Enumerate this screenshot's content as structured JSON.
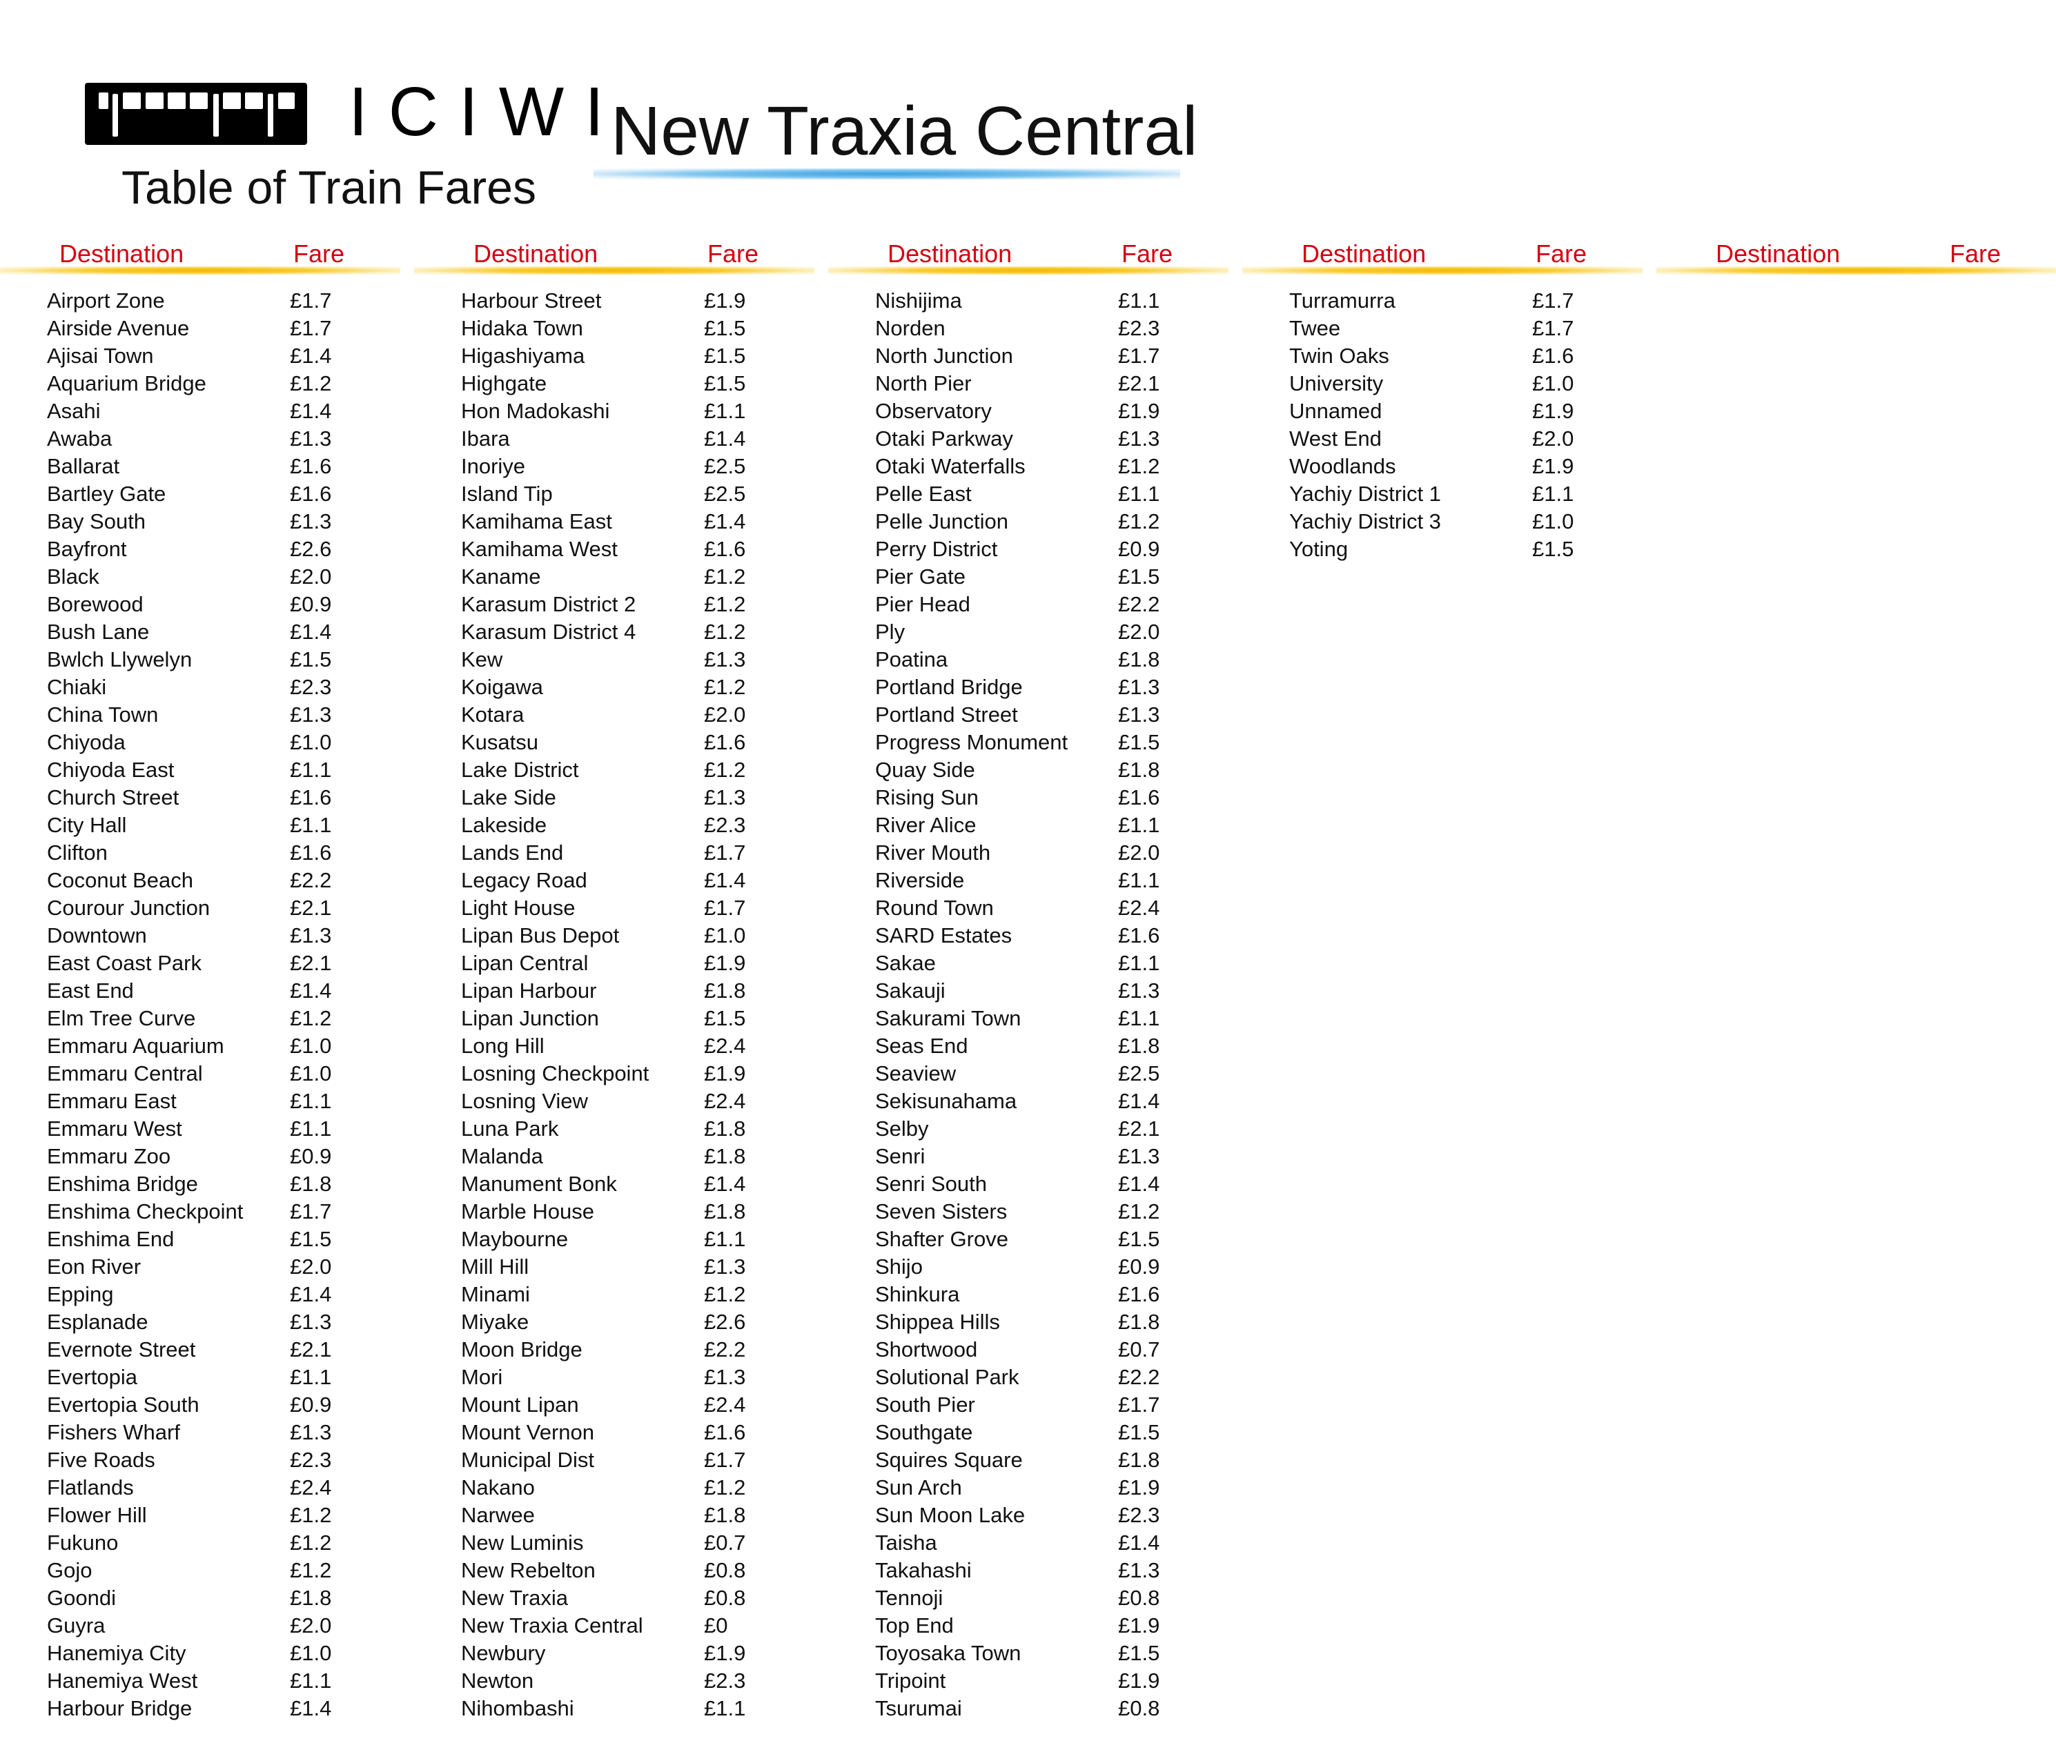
{
  "header": {
    "brand": "ICIWI",
    "subtitle": "Table of Train Fares",
    "station": "New Traxia Central"
  },
  "table": {
    "dest_header": "Destination",
    "fare_header": "Fare",
    "columns": [
      [
        {
          "d": "Airport Zone",
          "f": "£1.7"
        },
        {
          "d": "Airside Avenue",
          "f": "£1.7"
        },
        {
          "d": "Ajisai Town",
          "f": "£1.4"
        },
        {
          "d": "Aquarium Bridge",
          "f": "£1.2"
        },
        {
          "d": "Asahi",
          "f": "£1.4"
        },
        {
          "d": "Awaba",
          "f": "£1.3"
        },
        {
          "d": "Ballarat",
          "f": "£1.6"
        },
        {
          "d": "Bartley Gate",
          "f": "£1.6"
        },
        {
          "d": "Bay South",
          "f": "£1.3"
        },
        {
          "d": "Bayfront",
          "f": "£2.6"
        },
        {
          "d": "Black",
          "f": "£2.0"
        },
        {
          "d": "Borewood",
          "f": "£0.9"
        },
        {
          "d": "Bush Lane",
          "f": "£1.4"
        },
        {
          "d": "Bwlch Llywelyn",
          "f": "£1.5"
        },
        {
          "d": "Chiaki",
          "f": "£2.3"
        },
        {
          "d": "China Town",
          "f": "£1.3"
        },
        {
          "d": "Chiyoda",
          "f": "£1.0"
        },
        {
          "d": "Chiyoda East",
          "f": "£1.1"
        },
        {
          "d": "Church Street",
          "f": "£1.6"
        },
        {
          "d": "City Hall",
          "f": "£1.1"
        },
        {
          "d": "Clifton",
          "f": "£1.6"
        },
        {
          "d": "Coconut Beach",
          "f": "£2.2"
        },
        {
          "d": "Courour Junction",
          "f": "£2.1"
        },
        {
          "d": "Downtown",
          "f": "£1.3"
        },
        {
          "d": "East Coast Park",
          "f": "£2.1"
        },
        {
          "d": "East End",
          "f": "£1.4"
        },
        {
          "d": "Elm Tree Curve",
          "f": "£1.2"
        },
        {
          "d": "Emmaru Aquarium",
          "f": "£1.0"
        },
        {
          "d": "Emmaru Central",
          "f": "£1.0"
        },
        {
          "d": "Emmaru East",
          "f": "£1.1"
        },
        {
          "d": "Emmaru West",
          "f": "£1.1"
        },
        {
          "d": "Emmaru Zoo",
          "f": "£0.9"
        },
        {
          "d": "Enshima Bridge",
          "f": "£1.8"
        },
        {
          "d": "Enshima Checkpoint",
          "f": "£1.7"
        },
        {
          "d": "Enshima End",
          "f": "£1.5"
        },
        {
          "d": "Eon River",
          "f": "£2.0"
        },
        {
          "d": "Epping",
          "f": "£1.4"
        },
        {
          "d": "Esplanade",
          "f": "£1.3"
        },
        {
          "d": "Evernote Street",
          "f": "£2.1"
        },
        {
          "d": "Evertopia",
          "f": "£1.1"
        },
        {
          "d": "Evertopia South",
          "f": "£0.9"
        },
        {
          "d": "Fishers Wharf",
          "f": "£1.3"
        },
        {
          "d": "Five Roads",
          "f": "£2.3"
        },
        {
          "d": "Flatlands",
          "f": "£2.4"
        },
        {
          "d": "Flower Hill",
          "f": "£1.2"
        },
        {
          "d": "Fukuno",
          "f": "£1.2"
        },
        {
          "d": "Gojo",
          "f": "£1.2"
        },
        {
          "d": "Goondi",
          "f": "£1.8"
        },
        {
          "d": "Guyra",
          "f": "£2.0"
        },
        {
          "d": "Hanemiya City",
          "f": "£1.0"
        },
        {
          "d": "Hanemiya West",
          "f": "£1.1"
        },
        {
          "d": "Harbour Bridge",
          "f": "£1.4"
        }
      ],
      [
        {
          "d": "Harbour Street",
          "f": "£1.9"
        },
        {
          "d": "Hidaka Town",
          "f": "£1.5"
        },
        {
          "d": "Higashiyama",
          "f": "£1.5"
        },
        {
          "d": "Highgate",
          "f": "£1.5"
        },
        {
          "d": "Hon Madokashi",
          "f": "£1.1"
        },
        {
          "d": "Ibara",
          "f": "£1.4"
        },
        {
          "d": "Inoriye",
          "f": "£2.5"
        },
        {
          "d": "Island Tip",
          "f": "£2.5"
        },
        {
          "d": "Kamihama East",
          "f": "£1.4"
        },
        {
          "d": "Kamihama West",
          "f": "£1.6"
        },
        {
          "d": "Kaname",
          "f": "£1.2"
        },
        {
          "d": "Karasum District 2",
          "f": "£1.2"
        },
        {
          "d": "Karasum District 4",
          "f": "£1.2"
        },
        {
          "d": "Kew",
          "f": "£1.3"
        },
        {
          "d": "Koigawa",
          "f": "£1.2"
        },
        {
          "d": "Kotara",
          "f": "£2.0"
        },
        {
          "d": "Kusatsu",
          "f": "£1.6"
        },
        {
          "d": "Lake District",
          "f": "£1.2"
        },
        {
          "d": "Lake Side",
          "f": "£1.3"
        },
        {
          "d": "Lakeside",
          "f": "£2.3"
        },
        {
          "d": "Lands End",
          "f": "£1.7"
        },
        {
          "d": "Legacy Road",
          "f": "£1.4"
        },
        {
          "d": "Light House",
          "f": "£1.7"
        },
        {
          "d": "Lipan Bus Depot",
          "f": "£1.0"
        },
        {
          "d": "Lipan Central",
          "f": "£1.9"
        },
        {
          "d": "Lipan Harbour",
          "f": "£1.8"
        },
        {
          "d": "Lipan Junction",
          "f": "£1.5"
        },
        {
          "d": "Long Hill",
          "f": "£2.4"
        },
        {
          "d": "Losning Checkpoint",
          "f": "£1.9"
        },
        {
          "d": "Losning View",
          "f": "£2.4"
        },
        {
          "d": "Luna Park",
          "f": "£1.8"
        },
        {
          "d": "Malanda",
          "f": "£1.8"
        },
        {
          "d": "Manument Bonk",
          "f": "£1.4"
        },
        {
          "d": "Marble House",
          "f": "£1.8"
        },
        {
          "d": "Maybourne",
          "f": "£1.1"
        },
        {
          "d": "Mill Hill",
          "f": "£1.3"
        },
        {
          "d": "Minami",
          "f": "£1.2"
        },
        {
          "d": "Miyake",
          "f": "£2.6"
        },
        {
          "d": "Moon Bridge",
          "f": "£2.2"
        },
        {
          "d": "Mori",
          "f": "£1.3"
        },
        {
          "d": "Mount Lipan",
          "f": "£2.4"
        },
        {
          "d": "Mount Vernon",
          "f": "£1.6"
        },
        {
          "d": "Municipal Dist",
          "f": "£1.7"
        },
        {
          "d": "Nakano",
          "f": "£1.2"
        },
        {
          "d": "Narwee",
          "f": "£1.8"
        },
        {
          "d": "New Luminis",
          "f": "£0.7"
        },
        {
          "d": "New Rebelton",
          "f": "£0.8"
        },
        {
          "d": "New Traxia",
          "f": "£0.8"
        },
        {
          "d": "New Traxia Central",
          "f": "£0"
        },
        {
          "d": "Newbury",
          "f": "£1.9"
        },
        {
          "d": "Newton",
          "f": "£2.3"
        },
        {
          "d": "Nihombashi",
          "f": "£1.1"
        }
      ],
      [
        {
          "d": "Nishijima",
          "f": "£1.1"
        },
        {
          "d": "Norden",
          "f": "£2.3"
        },
        {
          "d": "North Junction",
          "f": "£1.7"
        },
        {
          "d": "North Pier",
          "f": "£2.1"
        },
        {
          "d": "Observatory",
          "f": "£1.9"
        },
        {
          "d": "Otaki Parkway",
          "f": "£1.3"
        },
        {
          "d": "Otaki Waterfalls",
          "f": "£1.2"
        },
        {
          "d": "Pelle East",
          "f": "£1.1"
        },
        {
          "d": "Pelle Junction",
          "f": "£1.2"
        },
        {
          "d": "Perry District",
          "f": "£0.9"
        },
        {
          "d": "Pier Gate",
          "f": "£1.5"
        },
        {
          "d": "Pier Head",
          "f": "£2.2"
        },
        {
          "d": "Ply",
          "f": "£2.0"
        },
        {
          "d": "Poatina",
          "f": "£1.8"
        },
        {
          "d": "Portland Bridge",
          "f": "£1.3"
        },
        {
          "d": "Portland Street",
          "f": "£1.3"
        },
        {
          "d": "Progress Monument",
          "f": "£1.5"
        },
        {
          "d": "Quay Side",
          "f": "£1.8"
        },
        {
          "d": "Rising Sun",
          "f": "£1.6"
        },
        {
          "d": "River Alice",
          "f": "£1.1"
        },
        {
          "d": "River Mouth",
          "f": "£2.0"
        },
        {
          "d": "Riverside",
          "f": "£1.1"
        },
        {
          "d": "Round Town",
          "f": "£2.4"
        },
        {
          "d": "SARD Estates",
          "f": "£1.6"
        },
        {
          "d": "Sakae",
          "f": "£1.1"
        },
        {
          "d": "Sakauji",
          "f": "£1.3"
        },
        {
          "d": "Sakurami Town",
          "f": "£1.1"
        },
        {
          "d": "Seas End",
          "f": "£1.8"
        },
        {
          "d": "Seaview",
          "f": "£2.5"
        },
        {
          "d": "Sekisunahama",
          "f": "£1.4"
        },
        {
          "d": "Selby",
          "f": "£2.1"
        },
        {
          "d": "Senri",
          "f": "£1.3"
        },
        {
          "d": "Senri South",
          "f": "£1.4"
        },
        {
          "d": "Seven Sisters",
          "f": "£1.2"
        },
        {
          "d": "Shafter Grove",
          "f": "£1.5"
        },
        {
          "d": "Shijo",
          "f": "£0.9"
        },
        {
          "d": "Shinkura",
          "f": "£1.6"
        },
        {
          "d": "Shippea Hills",
          "f": "£1.8"
        },
        {
          "d": "Shortwood",
          "f": "£0.7"
        },
        {
          "d": "Solutional Park",
          "f": "£2.2"
        },
        {
          "d": "South Pier",
          "f": "£1.7"
        },
        {
          "d": "Southgate",
          "f": "£1.5"
        },
        {
          "d": "Squires Square",
          "f": "£1.8"
        },
        {
          "d": "Sun Arch",
          "f": "£1.9"
        },
        {
          "d": "Sun Moon Lake",
          "f": "£2.3"
        },
        {
          "d": "Taisha",
          "f": "£1.4"
        },
        {
          "d": "Takahashi",
          "f": "£1.3"
        },
        {
          "d": "Tennoji",
          "f": "£0.8"
        },
        {
          "d": "Top End",
          "f": "£1.9"
        },
        {
          "d": "Toyosaka Town",
          "f": "£1.5"
        },
        {
          "d": "Tripoint",
          "f": "£1.9"
        },
        {
          "d": "Tsurumai",
          "f": "£0.8"
        }
      ],
      [
        {
          "d": "Turramurra",
          "f": "£1.7"
        },
        {
          "d": "Twee",
          "f": "£1.7"
        },
        {
          "d": "Twin Oaks",
          "f": "£1.6"
        },
        {
          "d": "University",
          "f": "£1.0"
        },
        {
          "d": "Unnamed",
          "f": "£1.9"
        },
        {
          "d": "West End",
          "f": "£2.0"
        },
        {
          "d": "Woodlands",
          "f": "£1.9"
        },
        {
          "d": "Yachiy District 1",
          "f": "£1.1"
        },
        {
          "d": "Yachiy District 3",
          "f": "£1.0"
        },
        {
          "d": "Yoting",
          "f": "£1.5"
        }
      ],
      []
    ]
  }
}
